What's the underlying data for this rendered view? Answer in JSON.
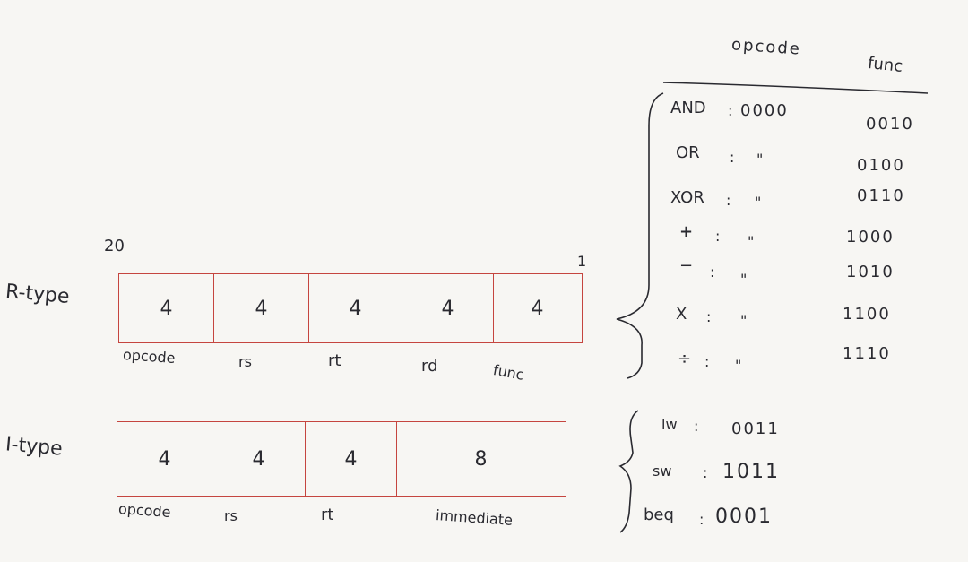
{
  "r_type": {
    "label": "R-type",
    "top_number": "20",
    "corner_mark": "1",
    "cells": [
      "4",
      "4",
      "4",
      "4",
      "4"
    ],
    "field_names": [
      "opcode",
      "rs",
      "rt",
      "rd",
      "func"
    ]
  },
  "i_type": {
    "label": "I-type",
    "cells": [
      "4",
      "4",
      "4",
      "8"
    ],
    "field_names": [
      "opcode",
      "rs",
      "rt",
      "immediate"
    ]
  },
  "table": {
    "header_opcode": "opcode",
    "header_func": "func",
    "rows": [
      {
        "op": "AND",
        "sep": ":",
        "opcode": "0000",
        "func": "0010"
      },
      {
        "op": "OR",
        "sep": ":",
        "opcode": "\"",
        "func": "0100"
      },
      {
        "op": "XOR",
        "sep": ":",
        "opcode": "\"",
        "func": "0110"
      },
      {
        "op": "+",
        "sep": ":",
        "opcode": "\"",
        "func": "1000"
      },
      {
        "op": "−",
        "sep": ":",
        "opcode": "\"",
        "func": "1010"
      },
      {
        "op": "X",
        "sep": ":",
        "opcode": "\"",
        "func": "1100"
      },
      {
        "op": "÷",
        "sep": ":",
        "opcode": "\"",
        "func": "1110"
      }
    ]
  },
  "i_ops": [
    {
      "op": "lw",
      "sep": ":",
      "opcode": "0011"
    },
    {
      "op": "sw",
      "sep": ":",
      "opcode": "1011"
    },
    {
      "op": "beq",
      "sep": ":",
      "opcode": "0001"
    }
  ],
  "colors": {
    "ink": "#2a2a30",
    "box_red": "#c5453f",
    "paper": "#f7f6f3"
  }
}
